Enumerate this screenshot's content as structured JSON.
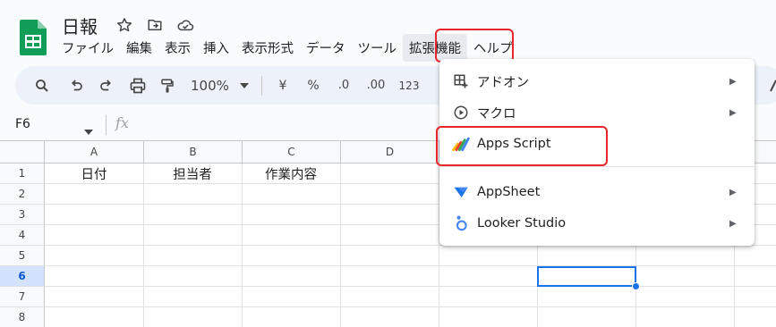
{
  "app": {
    "doc_title": "日報",
    "accent_color": "#0f9d58"
  },
  "menubar": {
    "items": [
      "ファイル",
      "編集",
      "表示",
      "挿入",
      "表示形式",
      "データ",
      "ツール",
      "拡張機能",
      "ヘルプ"
    ],
    "active_index": 7
  },
  "toolbar": {
    "zoom": "100%",
    "currency": "¥",
    "percent": "%",
    "decrease_decimal": ".0",
    "increase_decimal": ".00",
    "number_format": "123"
  },
  "formula_bar": {
    "cell_ref": "F6",
    "fx_label": "fx"
  },
  "grid": {
    "columns": [
      "A",
      "B",
      "C",
      "D"
    ],
    "rows": [
      "1",
      "2",
      "3",
      "4",
      "5",
      "6",
      "7",
      "8"
    ],
    "selected_row": "6",
    "selected_cell": "F6",
    "row1_values": [
      "日付",
      "担当者",
      "作業内容"
    ]
  },
  "extensions_menu": {
    "items": [
      {
        "label": "アドオン",
        "icon": "addons-icon",
        "has_submenu": true
      },
      {
        "label": "マクロ",
        "icon": "macro-play-icon",
        "has_submenu": true
      },
      {
        "label": "Apps Script",
        "icon": "apps-script-icon",
        "has_submenu": false
      },
      {
        "label": "AppSheet",
        "icon": "appsheet-icon",
        "has_submenu": true
      },
      {
        "label": "Looker Studio",
        "icon": "looker-studio-icon",
        "has_submenu": true
      }
    ],
    "submenu_arrow": "▶"
  },
  "highlight_color": "#e8262b"
}
